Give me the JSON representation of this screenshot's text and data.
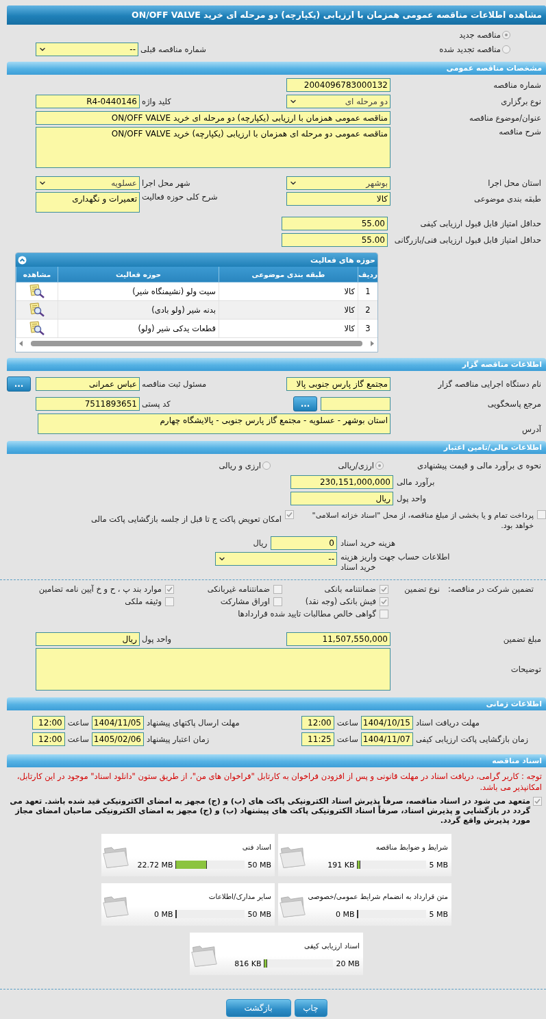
{
  "title": "مشاهده اطلاعات مناقصه عمومی همزمان با ارزیابی (یکپارچه) دو مرحله ای خرید ON/OFF VALVE",
  "tender_type": [
    {
      "label": "مناقصه جدید",
      "selected": true
    },
    {
      "label": "مناقصه تجدید شده",
      "selected": false
    }
  ],
  "previous_tender": {
    "label": "شماره مناقصه قبلی",
    "value": "--"
  },
  "general": {
    "heading": "مشخصات مناقصه عمومی",
    "tender_number": {
      "label": "شماره مناقصه",
      "value": "2004096783000132"
    },
    "holding_type": {
      "label": "نوع برگزاری",
      "value": "دو مرحله ای"
    },
    "keyword": {
      "label": "کلید واژه",
      "value": "R4-0440146"
    },
    "subject": {
      "label": "عنوان/موضوع مناقصه",
      "value": "مناقصه عمومی همزمان با ارزیابی (یکپارچه) دو مرحله ای خرید ON/OFF VALVE"
    },
    "description": {
      "label": "شرح مناقصه",
      "value": "مناقصه عمومی دو مرحله ای همزمان با ارزیابی (یکپارچه) خرید ON/OFF VALVE"
    },
    "province": {
      "label": "استان محل اجرا",
      "value": "بوشهر"
    },
    "city": {
      "label": "شهر محل اجرا",
      "value": "عسلویه"
    },
    "category": {
      "label": "طبقه بندی موضوعی",
      "value": "کالا"
    },
    "activity_summary": {
      "label": "شرح کلی حوزه فعالیت",
      "value": "تعمیرات و نگهداری"
    },
    "min_quality_score": {
      "label": "حداقل امتیاز قابل قبول ارزیابی کیفی",
      "value": "55.00"
    },
    "min_technical_score": {
      "label": "حداقل امتیاز قابل قبول ارزیابی فنی/بازرگانی",
      "value": "55.00"
    }
  },
  "activities": {
    "title": "حوزه های فعالیت",
    "columns": [
      "ردیف",
      "طبقه بندی موضوعی",
      "حوزه فعالیت",
      "مشاهده"
    ],
    "rows": [
      {
        "row": "1",
        "category": "کالا",
        "activity": "سیت ولو (نشیمنگاه شیر)"
      },
      {
        "row": "2",
        "category": "کالا",
        "activity": "بدنه شیر (ولو بادی)"
      },
      {
        "row": "3",
        "category": "کالا",
        "activity": "قطعات یدکی شیر (ولو)"
      }
    ]
  },
  "organizer": {
    "heading": "اطلاعات مناقصه گزار",
    "org_name": {
      "label": "نام دستگاه اجرایی مناقصه گزار",
      "value": "مجتمع گاز پارس جنوبی  پالا"
    },
    "registrar": {
      "label": "مسئول ثبت مناقصه",
      "value": "عباس عمرانی",
      "button": "..."
    },
    "reference": {
      "label": "مرجع پاسخگویی",
      "button": "..."
    },
    "postal_code": {
      "label": "کد پستی",
      "value": "7511893651"
    },
    "address": {
      "label": "آدرس",
      "value": "استان بوشهر - عسلویه - مجتمع گاز پارس جنوبی - پالایشگاه چهارم"
    }
  },
  "finance": {
    "heading": "اطلاعات مالی/تامین اعتبار",
    "pricing": {
      "label": "نحوه ی برآورد مالی و قیمت پیشنهادی",
      "options": [
        {
          "label": "ارزی/ریالی",
          "selected": true
        },
        {
          "label": "ارزی و ریالی",
          "selected": false
        }
      ]
    },
    "estimate": {
      "label": "برآورد مالی",
      "value": "230,151,000,000"
    },
    "currency": {
      "label": "واحد پول",
      "value": "ریال"
    },
    "treasury_payment": {
      "label": "پرداخت تمام و یا بخشی از مبلغ مناقصه، از محل \"اسناد خزانه اسلامی\" خواهد بود.",
      "checked": false
    },
    "envelope_swap": {
      "label": "امکان تعویض پاکت ج تا قبل از جلسه بازگشایی پاکت مالی",
      "checked": true
    },
    "document_fee": {
      "label": "هزینه خرید اسناد",
      "value": "0",
      "unit": "ریال"
    },
    "account_info": {
      "label": "اطلاعات حساب جهت واریز هزینه خرید اسناد",
      "value": "--"
    }
  },
  "guarantee": {
    "label": "تضمین شرکت در مناقصه:",
    "type_label": "نوع تضمین",
    "options": [
      {
        "label": "ضمانتنامه بانکی",
        "checked": true
      },
      {
        "label": "ضمانتنامه غیربانکی",
        "checked": false
      },
      {
        "label": "موارد بند پ ، ح و خ آیین نامه تضامین",
        "checked": true
      },
      {
        "label": "فیش بانکی (وجه نقد)",
        "checked": true
      },
      {
        "label": "اوراق مشارکت",
        "checked": false
      },
      {
        "label": "وثیقه ملکی",
        "checked": false
      },
      {
        "label": "گواهی خالص مطالبات تایید شده قراردادها",
        "checked": false
      }
    ],
    "amount": {
      "label": "مبلغ تضمین",
      "value": "11,507,550,000"
    },
    "currency": {
      "label": "واحد پول",
      "value": "ریال"
    },
    "notes": {
      "label": "توضیحات"
    }
  },
  "timing": {
    "heading": "اطلاعات زمانی",
    "items": [
      {
        "label": "مهلت دریافت اسناد",
        "date": "1404/10/15",
        "time_label": "ساعت",
        "time": "12:00"
      },
      {
        "label": "مهلت ارسال پاکتهای پیشنهاد",
        "date": "1404/11/05",
        "time_label": "ساعت",
        "time": "12:00"
      },
      {
        "label": "زمان بازگشایی پاکت ارزیابی کیفی",
        "date": "1404/11/07",
        "time_label": "ساعت",
        "time": "11:25"
      },
      {
        "label": "زمان اعتبار پیشنهاد",
        "date": "1405/02/06",
        "time_label": "ساعت",
        "time": "12:00"
      }
    ]
  },
  "documents": {
    "heading": "اسناد مناقصه",
    "notice": "توجه : کاربر گرامی، دریافت اسناد در مهلت قانونی و پس از افزودن فراخوان به کارتابل \"فراخوان های من\"، از طریق ستون \"دانلود اسناد\" موجود در این کارتابل، امکانپذیر می باشد.",
    "commitment": {
      "text": "متعهد می شود در اسناد مناقصه، صرفاً پذیرش اسناد الکترونیکی پاکت های (ب) و (ج) مجهز به امضای الکترونیکی قید شده باشد. تعهد می گردد در بازگشایی و پذیرش اسناد، صرفاً اسناد الکترونیکی پاکت های پیشنهاد (ب) و (ج) مجهز به امضای الکترونیکی صاحبان امضای مجاز مورد پذیرش واقع گردد.",
      "checked": true
    },
    "files": [
      {
        "name": "شرایط و ضوابط مناقصه",
        "used": "191 KB",
        "max": "5 MB",
        "level": 0.04
      },
      {
        "name": "اسناد فنی",
        "used": "22.72 MB",
        "max": "50 MB",
        "level": 0.45
      },
      {
        "name": "متن قرارداد به انضمام شرایط عمومی/خصوصی",
        "used": "0 MB",
        "max": "5 MB",
        "level": 0
      },
      {
        "name": "سایر مدارک/اطلاعات",
        "used": "0 MB",
        "max": "50 MB",
        "level": 0
      },
      {
        "name": "اسناد ارزیابی کیفی",
        "used": "816 KB",
        "max": "20 MB",
        "level": 0.04
      }
    ]
  },
  "buttons": [
    "چاپ",
    "بازگشت"
  ]
}
